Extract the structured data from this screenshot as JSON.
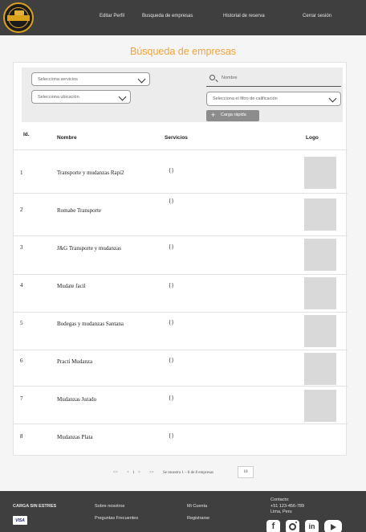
{
  "header": {
    "logo_text": "CARGA SIN ESTRES",
    "nav": {
      "editar_perfil": "Editar Perfil",
      "busqueda": "Busqueda de empresas",
      "historial": "Historial de reserva",
      "cerrar_sesion": "Cerrar sesión"
    }
  },
  "page_title": "Búsqueda de empresas",
  "filters": {
    "servicios_placeholder": "Selecciona servicios",
    "ubicacion_placeholder": "Selecciona ubicación",
    "nombre_placeholder": "Nombre",
    "calificacion_placeholder": "Selecciona el filtro de calificación",
    "carga_rapida_label": "Carga rápida"
  },
  "table": {
    "headers": {
      "id": "Id.",
      "nombre": "Nombre",
      "servicios": "Servicios",
      "logo": "Logo"
    },
    "rows": [
      {
        "id": "1",
        "nombre": "Transporte y mudanzas Rapi2",
        "servicios": "{}"
      },
      {
        "id": "2",
        "nombre": "Romabe Transporte",
        "servicios": "{}"
      },
      {
        "id": "3",
        "nombre": "J&G Transporte y mudanzas",
        "servicios": "{}"
      },
      {
        "id": "4",
        "nombre": "Mudate facil",
        "servicios": "{}"
      },
      {
        "id": "5",
        "nombre": "Bodegas y mudanzas Santana",
        "servicios": "{}"
      },
      {
        "id": "6",
        "nombre": "Practi Mudanza",
        "servicios": "{}"
      },
      {
        "id": "7",
        "nombre": "Mudanzas Jurado",
        "servicios": "{}"
      },
      {
        "id": "8",
        "nombre": "Mudanzas Plata",
        "servicios": "{}"
      }
    ]
  },
  "pagination": {
    "first": "<<",
    "prev": "<",
    "page": "1",
    "next": ">",
    "last": ">>",
    "summary": "Se muestra 1 – 8 de 8 empresas",
    "per_page": "10"
  },
  "footer": {
    "brand": "CARGA SIN ESTRES",
    "card": "VISA",
    "sobre_nosotros": "Sobre nosotros",
    "preguntas": "Preguntas Frecuentes",
    "mi_cuenta": "Mi Cuenta",
    "registrarse": "Registrarse",
    "contacto_label": "Contacto:",
    "telefono": "+51 123-456-789",
    "ciudad": "Lima, Peru",
    "social_facebook": "f",
    "social_linkedin": "in"
  },
  "colors": {
    "accent": "#f4a33a",
    "header_bg": "#3f3f3f",
    "logo_gold": "#d9a21b"
  }
}
